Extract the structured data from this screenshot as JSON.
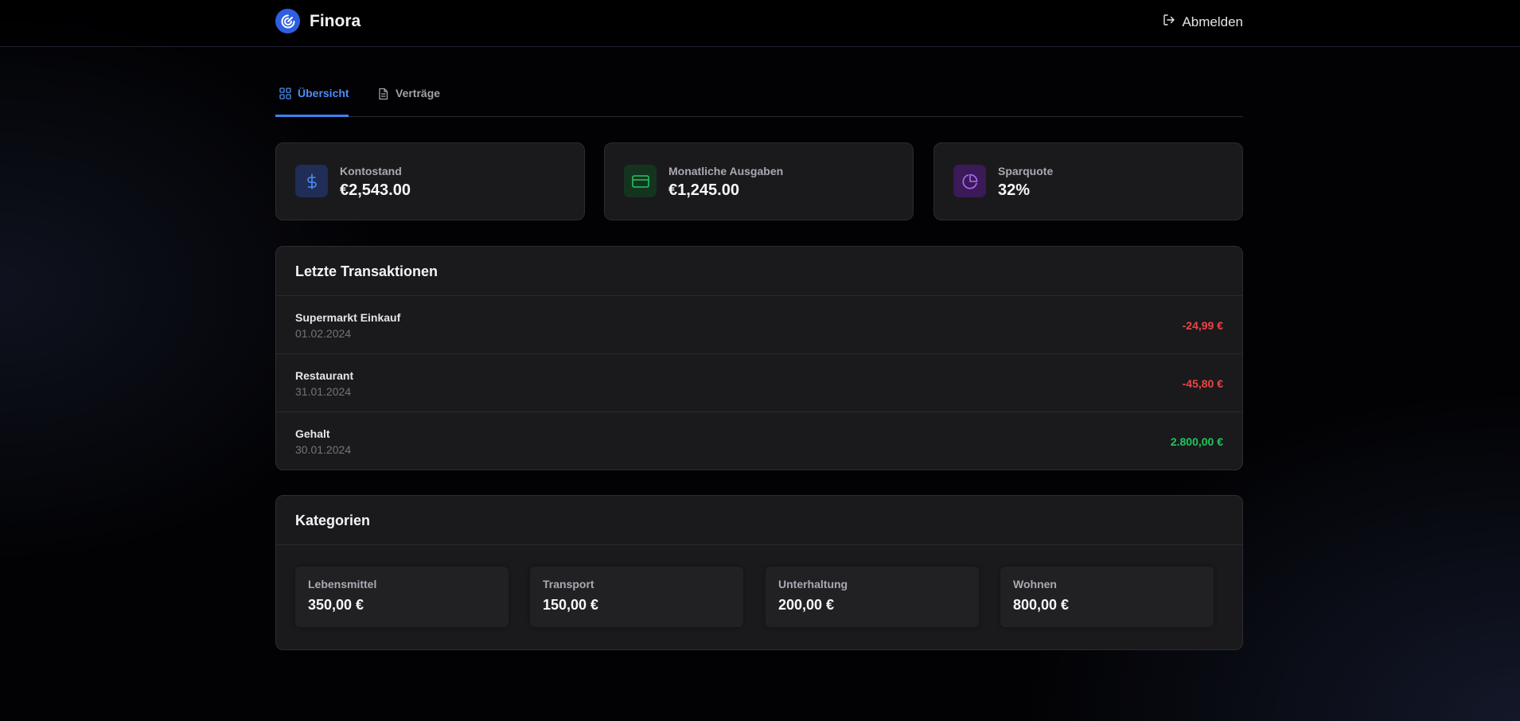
{
  "app": {
    "name": "Finora"
  },
  "header": {
    "logout_label": "Abmelden"
  },
  "tabs": [
    {
      "label": "Übersicht",
      "active": true,
      "icon": "grid-icon"
    },
    {
      "label": "Verträge",
      "active": false,
      "icon": "document-icon"
    }
  ],
  "stats": [
    {
      "label": "Kontostand",
      "value": "€2,543.00",
      "icon": "dollar-icon",
      "color": "#3b82f6"
    },
    {
      "label": "Monatliche Ausgaben",
      "value": "€1,245.00",
      "icon": "credit-card-icon",
      "color": "#22c55e"
    },
    {
      "label": "Sparquote",
      "value": "32%",
      "icon": "pie-chart-icon",
      "color": "#a855f7"
    }
  ],
  "transactions": {
    "title": "Letzte Transaktionen",
    "items": [
      {
        "name": "Supermarkt Einkauf",
        "date": "01.02.2024",
        "amount": "-24,99 €",
        "type": "expense"
      },
      {
        "name": "Restaurant",
        "date": "31.01.2024",
        "amount": "-45,80 €",
        "type": "expense"
      },
      {
        "name": "Gehalt",
        "date": "30.01.2024",
        "amount": "2.800,00 €",
        "type": "income"
      }
    ]
  },
  "categories": {
    "title": "Kategorien",
    "items": [
      {
        "label": "Lebensmittel",
        "value": "350,00 €"
      },
      {
        "label": "Transport",
        "value": "150,00 €"
      },
      {
        "label": "Unterhaltung",
        "value": "200,00 €"
      },
      {
        "label": "Wohnen",
        "value": "800,00 €"
      }
    ]
  },
  "colors": {
    "accent": "#3b82f6",
    "expense": "#ef4444",
    "income": "#22c55e"
  }
}
